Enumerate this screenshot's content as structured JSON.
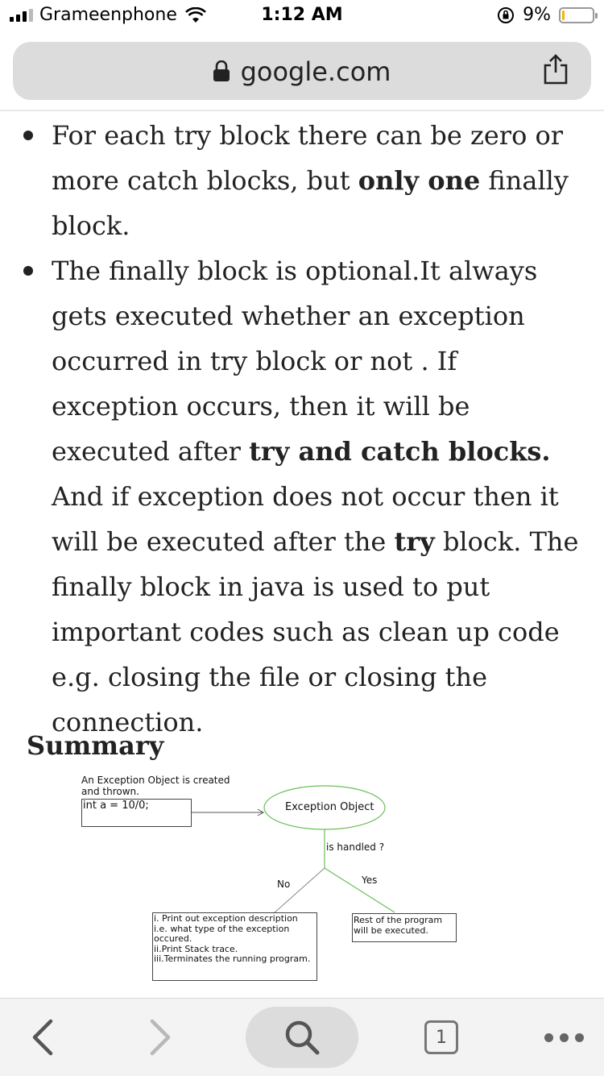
{
  "status_bar": {
    "carrier": "Grameenphone",
    "time": "1:12 AM",
    "battery_percent": "9%",
    "battery_level": 0.09,
    "battery_color": "#f5b400"
  },
  "browser": {
    "url": "google.com",
    "lock_icon": "lock-icon",
    "share_icon": "share-icon"
  },
  "article": {
    "bullet1": {
      "part1": "For each try block there can be zero or more catch blocks, but ",
      "bold1": "only one",
      "part2": " finally block."
    },
    "bullet2": {
      "part1": "The finally block is optional.It always gets executed whether an exception occurred in try block or not . If exception occurs, then it will be executed after ",
      "bold1": "try and catch blocks.",
      "part2": " And if exception does not occur then it will be executed after the ",
      "bold2": "try",
      "part3": " block. The finally block in java is used to put important codes such as clean up code e.g. closing the file or closing the connection."
    },
    "summary_heading": "Summary"
  },
  "diagram": {
    "created_label": "An Exception Object is created\nand thrown.",
    "code": "int a = 10/0;",
    "exception_object": "Exception Object",
    "is_handled": "is handled ?",
    "no_label": "No",
    "yes_label": "Yes",
    "no_box": "i. Print out exception description\ni.e. what type of the exception\noccured.\nii.Print Stack trace.\niii.Terminates  the running program.",
    "yes_box": "Rest of the program\nwill be executed.",
    "ellipse_color": "#6bbf5a"
  },
  "toolbar": {
    "back_icon": "back-chevron-icon",
    "forward_icon": "forward-chevron-icon",
    "search_icon": "search-icon",
    "tab_count": "1",
    "more_icon": "more-dots-icon"
  }
}
